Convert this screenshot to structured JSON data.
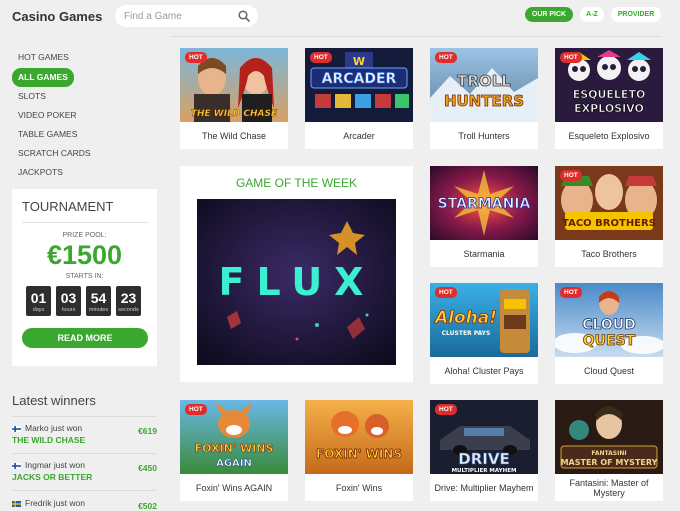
{
  "header": {
    "title": "Casino Games",
    "search_placeholder": "Find a Game",
    "search_icon": "search-icon",
    "filters": [
      {
        "label": "OUR PICK",
        "active": true
      },
      {
        "label": "A-Z",
        "active": false
      },
      {
        "label": "PROVIDER",
        "active": false
      }
    ]
  },
  "nav": {
    "items": [
      {
        "label": "HOT GAMES",
        "active": false
      },
      {
        "label": "ALL GAMES",
        "active": true
      },
      {
        "label": "SLOTS",
        "active": false
      },
      {
        "label": "VIDEO POKER",
        "active": false
      },
      {
        "label": "TABLE GAMES",
        "active": false
      },
      {
        "label": "SCRATCH CARDS",
        "active": false
      },
      {
        "label": "JACKPOTS",
        "active": false
      }
    ]
  },
  "tournament": {
    "title": "TOURNAMENT",
    "prize_label": "PRIZE POOL:",
    "prize_amount": "€1500",
    "starts_label": "STARTS IN:",
    "timer": [
      {
        "value": "01",
        "unit": "days"
      },
      {
        "value": "03",
        "unit": "hours"
      },
      {
        "value": "54",
        "unit": "minutes"
      },
      {
        "value": "23",
        "unit": "seconds"
      }
    ],
    "button_label": "READ MORE"
  },
  "winners": {
    "title": "Latest winners",
    "items": [
      {
        "who": "Marko just won",
        "game": "THE WILD CHASE",
        "amount": "€619",
        "flag": "finland-flag-icon"
      },
      {
        "who": "Ingmar just won",
        "game": "JACKS OR BETTER",
        "amount": "€450",
        "flag": "finland-flag-icon"
      },
      {
        "who": "Fredrik just won",
        "game": "",
        "amount": "€502",
        "flag": "sweden-flag-icon"
      }
    ]
  },
  "game_of_week": {
    "title": "GAME OF THE WEEK",
    "logo": "FLUX"
  },
  "games": [
    {
      "name": "The Wild Chase",
      "hot": true,
      "logo": "THE WILD CHASE"
    },
    {
      "name": "Arcader",
      "hot": true,
      "logo": "ARCADER"
    },
    {
      "name": "Troll Hunters",
      "hot": true,
      "logo": "TROLL HUNTERS"
    },
    {
      "name": "Esqueleto Explosivo",
      "hot": true,
      "logo": "ESQUELETO EXPLOSIVO"
    },
    {
      "name": "Starmania",
      "hot": false,
      "logo": "STARMANIA"
    },
    {
      "name": "Taco Brothers",
      "hot": true,
      "logo": "TACO BROTHERS"
    },
    {
      "name": "Aloha! Cluster Pays",
      "hot": true,
      "logo": "Aloha!"
    },
    {
      "name": "Cloud Quest",
      "hot": true,
      "logo": "CLOUD QUEST"
    },
    {
      "name": "Foxin' Wins AGAIN",
      "hot": true,
      "logo": "FOXIN' WINS AGAIN"
    },
    {
      "name": "Foxin' Wins",
      "hot": false,
      "logo": "FOXIN' WINS"
    },
    {
      "name": "Drive: Multiplier Mayhem",
      "hot": true,
      "logo": "DRIVE"
    },
    {
      "name": "Fantasini: Master of Mystery",
      "hot": false,
      "logo": "FANTASINI MASTER OF MYSTERY"
    }
  ],
  "hot_label": "HOT",
  "colors": {
    "accent": "#3aa82e",
    "hot": "#e02c2c",
    "page_bg": "#efefef"
  }
}
